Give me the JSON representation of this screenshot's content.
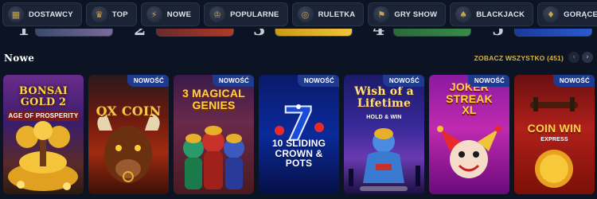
{
  "categories": [
    {
      "label": "DOSTAWCY",
      "icon": "grid-icon",
      "glyph": "▦"
    },
    {
      "label": "TOP",
      "icon": "laurel-icon",
      "glyph": "♛"
    },
    {
      "label": "NOWE",
      "icon": "lightning-icon",
      "glyph": "⚡"
    },
    {
      "label": "POPULARNE",
      "icon": "crown-icon",
      "glyph": "♔"
    },
    {
      "label": "RULETKA",
      "icon": "roulette-icon",
      "glyph": "◎"
    },
    {
      "label": "GRY SHOW",
      "icon": "show-icon",
      "glyph": "⚑"
    },
    {
      "label": "BLACKJACK",
      "icon": "cards-icon",
      "glyph": "♠"
    },
    {
      "label": "GORĄCE JACKPOTY",
      "icon": "jackpot-icon",
      "glyph": "♦"
    },
    {
      "label": "",
      "icon": "more-icon",
      "glyph": "▤"
    }
  ],
  "top_ranks": [
    "1",
    "2",
    "3",
    "4",
    "5"
  ],
  "section": {
    "title": "Nowe",
    "see_all": "ZOBACZ WSZYSTKO (451)",
    "prev_icon": "chevron-left-icon",
    "next_icon": "chevron-right-icon"
  },
  "badge_label": "NOWOŚĆ",
  "games": [
    {
      "title": "BONSAI GOLD 2",
      "subtitle": "AGE OF PROSPERITY",
      "badge": false
    },
    {
      "title": "OX COIN",
      "subtitle": "",
      "badge": true
    },
    {
      "title": "3 MAGICAL GENIES",
      "subtitle": "",
      "badge": true
    },
    {
      "title": "10 SLIDING CROWN & POTS",
      "subtitle": "",
      "badge": true
    },
    {
      "title": "Wish of a Lifetime",
      "subtitle": "HOLD & WIN",
      "badge": true
    },
    {
      "title": "JOKER STREAK XL",
      "subtitle": "",
      "badge": true
    },
    {
      "title": "COIN WIN",
      "subtitle": "EXPRESS",
      "badge": true
    }
  ]
}
